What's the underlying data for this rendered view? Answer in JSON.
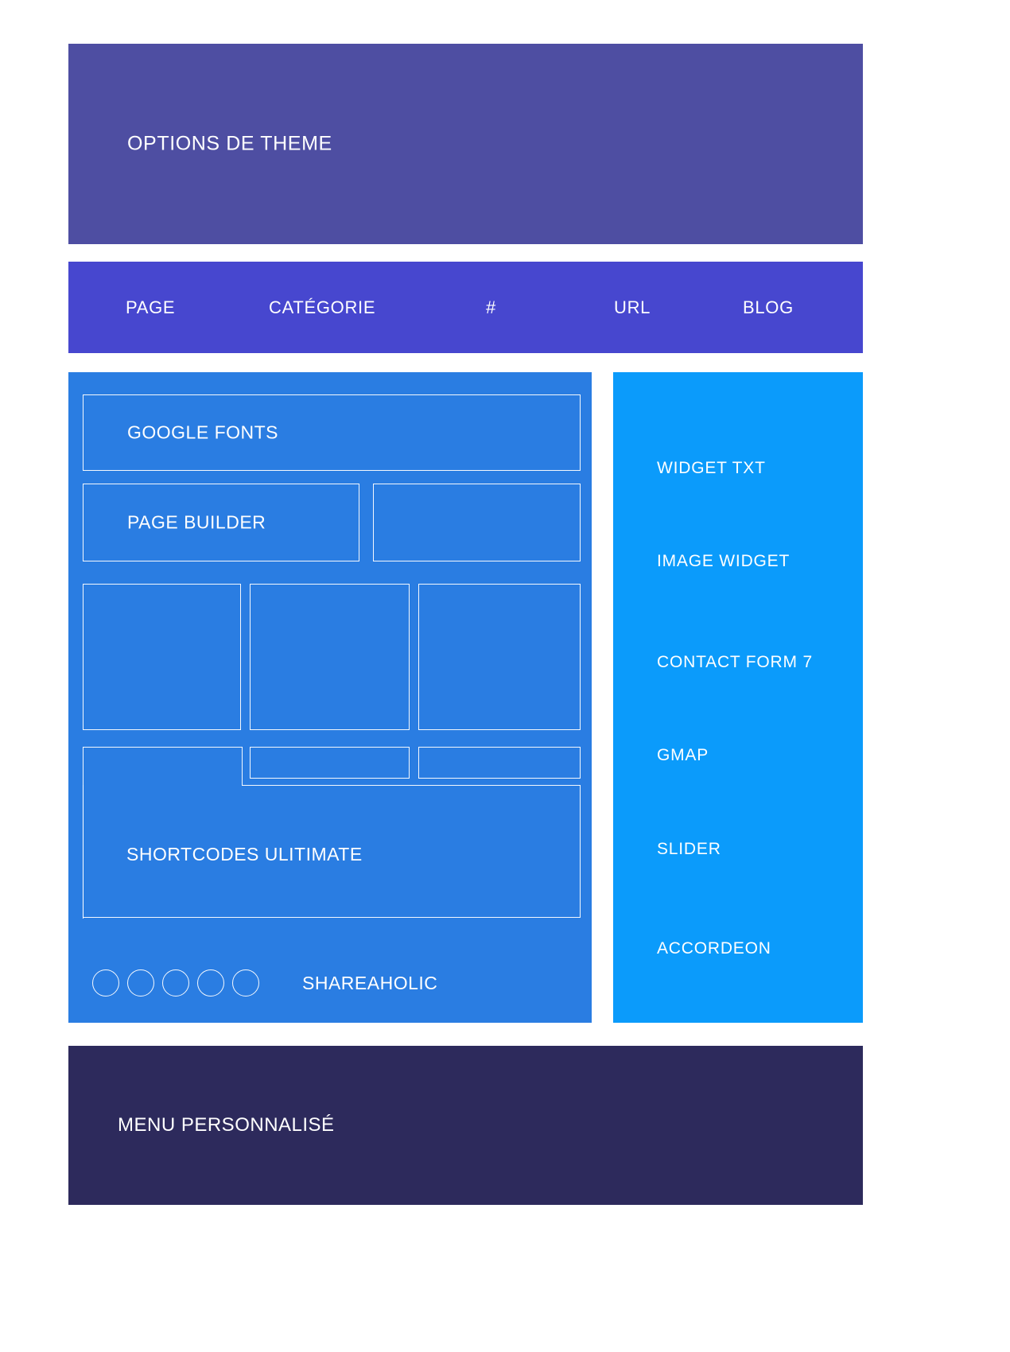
{
  "header": {
    "title": "OPTIONS DE THEME",
    "bg_color": "#4e4ea2"
  },
  "nav": {
    "bg_color": "#4747cf",
    "items": [
      {
        "label": "PAGE"
      },
      {
        "label": "CATÉGORIE"
      },
      {
        "label": "#"
      },
      {
        "label": "URL"
      },
      {
        "label": "BLOG"
      }
    ]
  },
  "content": {
    "bg_color": "#2a7de2",
    "border_color": "#ffffff",
    "boxes": [
      {
        "name": "google-fonts",
        "label": "GOOGLE FONTS"
      },
      {
        "name": "page-builder",
        "label": "PAGE BUILDER"
      },
      {
        "name": "row2-blank",
        "label": ""
      },
      {
        "name": "row3-a",
        "label": ""
      },
      {
        "name": "row3-b",
        "label": ""
      },
      {
        "name": "row3-c",
        "label": ""
      },
      {
        "name": "row4-b",
        "label": ""
      },
      {
        "name": "row4-c",
        "label": ""
      }
    ],
    "shortcodes_label": "SHORTCODES ULITIMATE",
    "shareaholic": {
      "label": "SHAREAHOLIC",
      "circle_count": 5
    }
  },
  "sidebar": {
    "bg_color": "#0b9bfb",
    "items": [
      {
        "label": "WIDGET TXT"
      },
      {
        "label": "IMAGE WIDGET"
      },
      {
        "label": "CONTACT FORM 7"
      },
      {
        "label": "GMAP"
      },
      {
        "label": "SLIDER"
      },
      {
        "label": "ACCORDEON"
      }
    ]
  },
  "footer": {
    "title": "MENU PERSONNALISÉ",
    "bg_color": "#2d2a5c"
  }
}
